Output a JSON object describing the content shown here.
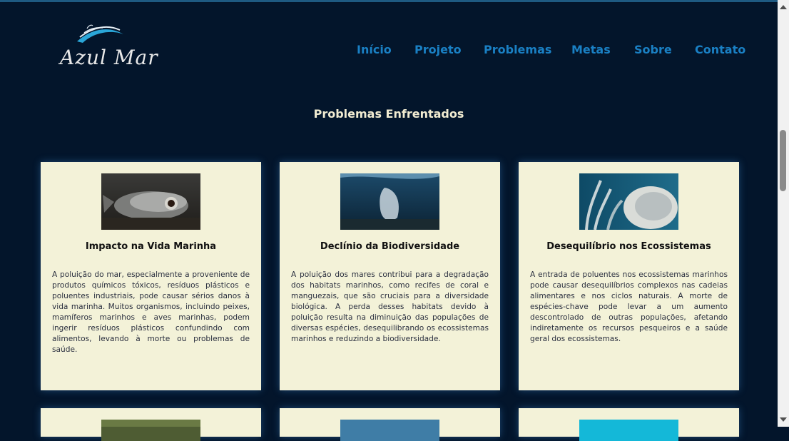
{
  "header": {
    "logo_text": "Azul Mar",
    "nav": [
      {
        "label": "Início",
        "name": "nav-inicio"
      },
      {
        "label": "Projeto",
        "name": "nav-projeto"
      },
      {
        "label": "Problemas",
        "name": "nav-problemas"
      },
      {
        "label": "Metas",
        "name": "nav-metas"
      },
      {
        "label": "Sobre",
        "name": "nav-sobre"
      },
      {
        "label": "Contato",
        "name": "nav-contato"
      }
    ]
  },
  "main": {
    "section_title": "Problemas Enfrentados",
    "cards": [
      {
        "title": "Impacto na Vida Marinha",
        "image": "dead-fish-on-beach",
        "text": "A poluição do mar, especialmente a proveniente de produtos químicos tóxicos, resíduos plásticos e poluentes industriais, pode causar sérios danos à vida marinha. Muitos organismos, incluindo peixes, mamíferos marinhos e aves marinhas, podem ingerir resíduos plásticos confundindo com alimentos, levando à morte ou problemas de saúde."
      },
      {
        "title": "Declínio da Biodiversidade",
        "image": "plastic-bag-underwater",
        "text": "A poluição dos mares contribui para a degradação dos habitats marinhos, como recifes de coral e manguezais, que são cruciais para a diversidade biológica. A perda desses habitats devido à poluição resulta na diminuição das populações de diversas espécies, desequilibrando os ecossistemas marinhos e reduzindo a biodiversidade."
      },
      {
        "title": "Desequilíbrio nos Ecossistemas",
        "image": "bleached-coral",
        "text": "A entrada de poluentes nos ecossistemas marinhos pode causar desequilíbrios complexos nas cadeias alimentares e nos ciclos naturais. A morte de espécies-chave pode levar a um aumento descontrolado de outras populações, afetando indiretamente os recursos pesqueiros e a saúde geral dos ecossistemas."
      }
    ],
    "row2_images": [
      "green-scene",
      "blue-water",
      "cyan-water"
    ]
  },
  "colors": {
    "background": "#03152b",
    "nav_link": "#1a80c4",
    "card_bg": "#f3f2d8",
    "title_text": "#f2ecd2"
  }
}
